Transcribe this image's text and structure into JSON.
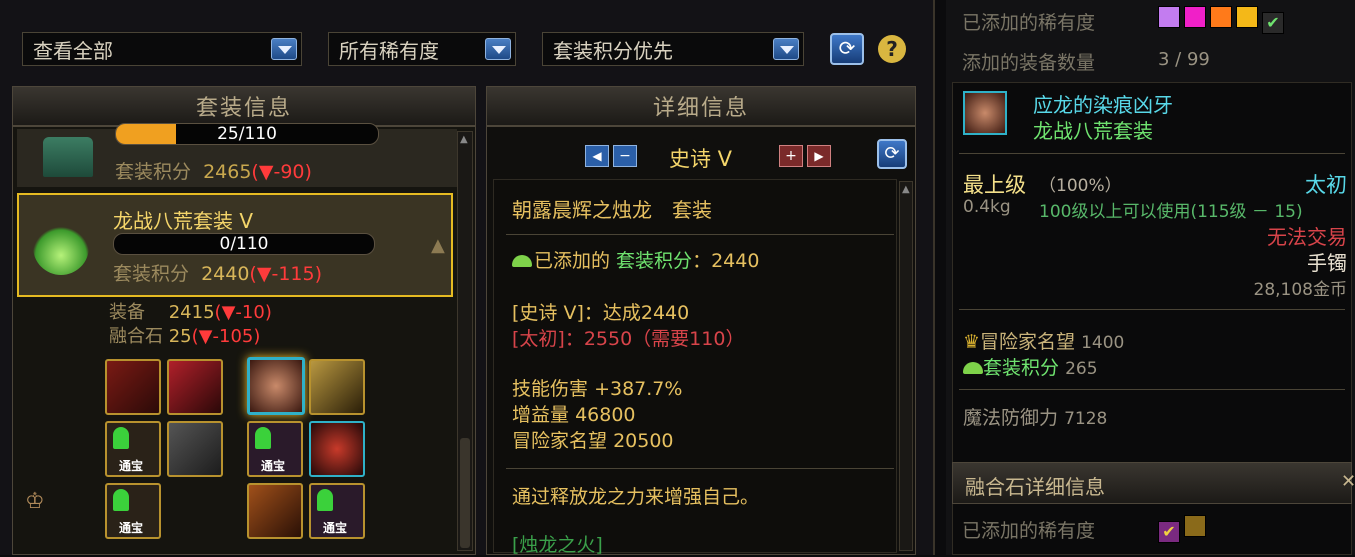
{
  "filters": {
    "view": "查看全部",
    "rarity": "所有稀有度",
    "sort": "套装积分优先"
  },
  "headers": {
    "left": "套装信息",
    "mid": "详细信息"
  },
  "set_prev": {
    "progress": "25/110",
    "score_label": "套装积分",
    "score": "2465",
    "delta_open": "(",
    "delta_arrow": "▼",
    "delta": "-90",
    "delta_close": ")"
  },
  "set_sel": {
    "name": "龙战八荒套装 V",
    "progress": "0/110",
    "score_label": "套装积分",
    "score": "2440",
    "delta_open": "(",
    "delta_arrow": "▼",
    "delta": "-115",
    "delta_close": ")",
    "equip_label": "装备",
    "equip_value": "2415",
    "equip_delta": "-10",
    "fusion_label": "融合石",
    "fusion_value": "25",
    "fusion_delta": "-105",
    "tongbao": "通宝"
  },
  "detail": {
    "grade": "史诗 V",
    "set_title": "朝露晨辉之烛龙　套装",
    "added_label": "已添加的 ",
    "score_label": "套装积分",
    "score_val": "：2440",
    "epic_line": "[史诗 V]：达成2440",
    "taichu_line": "[太初]：2550（需要110）",
    "stats": [
      {
        "label": "技能伤害",
        "value": "+387.7%"
      },
      {
        "label": "增益量",
        "value": "46800"
      },
      {
        "label": "冒险家名望",
        "value": "20500"
      }
    ],
    "desc": "通过释放龙之力来增强自己。",
    "skill": "[烛龙之火]"
  },
  "right": {
    "rarity_label": "已添加的稀有度",
    "count_label": "添加的装备数量",
    "count": "3 / 99",
    "item_name": "应龙的染痕凶牙",
    "item_set": "龙战八荒套装",
    "level_label": "最上级",
    "level_pct": "（100%）",
    "tier": "太初",
    "weight": "0.4kg",
    "use_req": "100级以上可以使用(115级 － 15)",
    "trade": "无法交易",
    "slot": "手镯",
    "price": "28,108金币",
    "fame_label": "冒险家名望",
    "fame": "1400",
    "set_score_label": "套装积分",
    "set_score": "265",
    "mdef_label": "魔法防御力",
    "mdef": "7128",
    "fusion_header": "融合石详细信息",
    "fusion_rarity_label": "已添加的稀有度"
  },
  "colors": {
    "gold": "#e9c46a",
    "red": "#ff3b3b",
    "green": "#6fe36f",
    "cyan": "#58d8e8"
  }
}
